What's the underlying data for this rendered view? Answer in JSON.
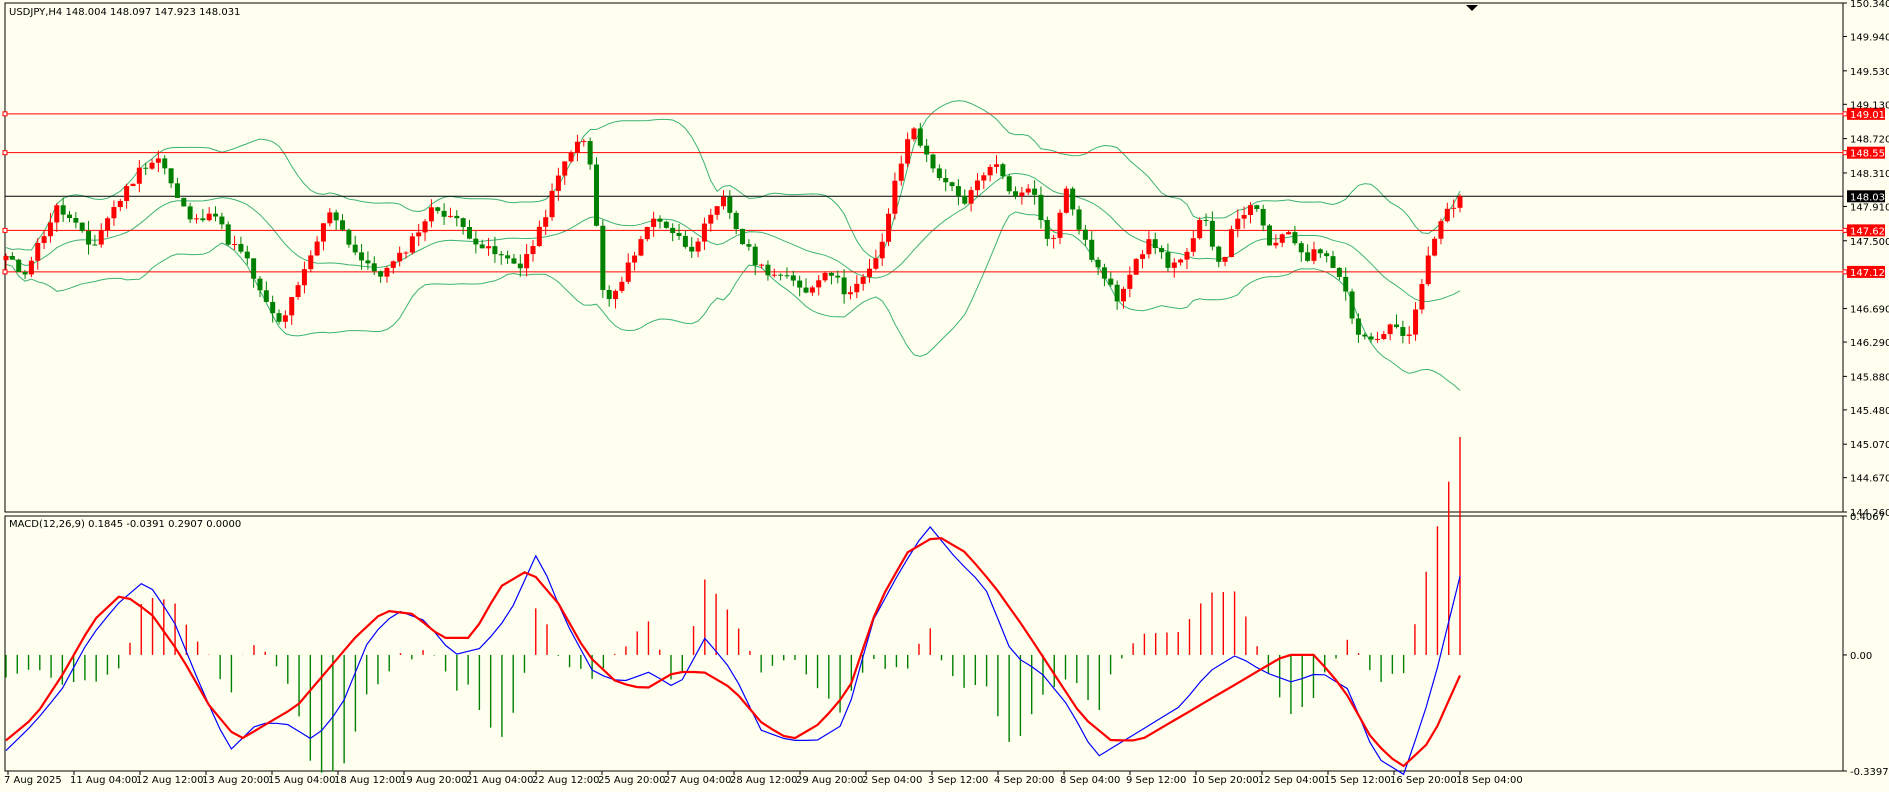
{
  "header": {
    "main_info": "USDJPY,H4  148.004 148.097 147.923 148.031",
    "macd_info": "MACD(12,26,9) 0.1845 -0.0391 0.2907 0.0000"
  },
  "colors": {
    "background": "#fffff0",
    "bull": "#ff0000",
    "bear": "#008000",
    "bollinger": "#3cb371",
    "level_line": "#ff0000",
    "current_price_line": "#000000",
    "macd_line": "#0000ff",
    "signal_line": "#ff0000",
    "hist_pos": "#ff0000",
    "hist_neg": "#008000"
  },
  "chart_data": [
    {
      "type": "candlestick",
      "symbol": "USDJPY",
      "timeframe": "H4",
      "ylim": [
        144.26,
        150.34
      ],
      "y_ticks": [
        "150.340",
        "149.940",
        "149.530",
        "149.130",
        "148.720",
        "148.310",
        "147.910",
        "147.500",
        "146.690",
        "146.290",
        "145.880",
        "145.480",
        "145.070",
        "144.670",
        "144.260"
      ],
      "x_ticks": [
        "7 Aug 2025",
        "11 Aug 04:00",
        "12 Aug 12:00",
        "13 Aug 20:00",
        "15 Aug 04:00",
        "18 Aug 12:00",
        "19 Aug 20:00",
        "21 Aug 04:00",
        "22 Aug 12:00",
        "25 Aug 20:00",
        "27 Aug 04:00",
        "28 Aug 12:00",
        "29 Aug 20:00",
        "2 Sep 04:00",
        "3 Sep 12:00",
        "4 Sep 20:00",
        "8 Sep 04:00",
        "9 Sep 12:00",
        "10 Sep 20:00",
        "12 Sep 04:00",
        "15 Sep 12:00",
        "16 Sep 20:00",
        "18 Sep 04:00"
      ],
      "levels": [
        {
          "value": 149.016,
          "label": "149.016"
        },
        {
          "value": 148.552,
          "label": "148.552"
        },
        {
          "value": 147.624,
          "label": "147.624"
        },
        {
          "value": 147.128,
          "label": "147.128"
        }
      ],
      "current_price": {
        "value": 148.031,
        "label": "148.031"
      },
      "anchors": [
        147.3,
        147.1,
        147.5,
        147.9,
        147.7,
        147.4,
        147.8,
        148.1,
        148.4,
        148.5,
        148.0,
        147.7,
        147.9,
        147.5,
        147.3,
        146.8,
        146.5,
        146.9,
        147.4,
        147.9,
        147.5,
        147.2,
        147.1,
        147.3,
        147.6,
        147.9,
        147.8,
        147.6,
        147.4,
        147.3,
        147.2,
        147.5,
        148.1,
        148.6,
        148.7,
        146.7,
        147.0,
        147.5,
        147.8,
        147.6,
        147.4,
        147.7,
        148.0,
        147.5,
        147.2,
        147.1,
        147.0,
        146.9,
        147.2,
        146.9,
        147.0,
        147.3,
        148.2,
        148.9,
        148.4,
        148.2,
        147.9,
        148.3,
        148.4,
        148.0,
        148.2,
        147.4,
        148.1,
        147.5,
        147.1,
        146.8,
        147.3,
        147.5,
        147.2,
        147.3,
        147.8,
        147.2,
        147.8,
        147.9,
        147.4,
        147.6,
        147.3,
        147.4,
        147.1,
        146.4,
        146.3,
        146.5,
        146.3,
        147.2,
        147.8,
        148.031
      ],
      "series_count": 230
    },
    {
      "type": "macd",
      "name": "MACD(12,26,9)",
      "ylim": [
        -0.3397,
        0.4067
      ],
      "y_ticks": [
        "0.4067",
        "0.00",
        "-0.3397"
      ],
      "macd_anchors": [
        -0.28,
        -0.2,
        -0.1,
        0.05,
        0.15,
        0.22,
        0.1,
        -0.1,
        -0.28,
        -0.2,
        -0.2,
        -0.25,
        -0.15,
        0.05,
        0.13,
        0.1,
        0.0,
        0.02,
        0.12,
        0.3,
        0.1,
        -0.05,
        -0.08,
        -0.05,
        -0.1,
        0.05,
        -0.05,
        -0.22,
        -0.25,
        -0.25,
        -0.2,
        0.1,
        0.25,
        0.38,
        0.28,
        0.2,
        0.0,
        -0.05,
        -0.15,
        -0.3,
        -0.25,
        -0.2,
        -0.15,
        -0.05,
        0.0,
        -0.05,
        -0.08,
        -0.05,
        -0.1,
        -0.3,
        -0.35,
        -0.1,
        0.23
      ],
      "signal_anchors": [
        -0.25,
        -0.18,
        -0.05,
        0.1,
        0.18,
        0.12,
        0.0,
        -0.15,
        -0.25,
        -0.2,
        -0.15,
        -0.05,
        0.05,
        0.13,
        0.12,
        0.05,
        0.05,
        0.2,
        0.25,
        0.15,
        0.0,
        -0.08,
        -0.1,
        -0.05,
        -0.05,
        -0.1,
        -0.2,
        -0.25,
        -0.2,
        -0.1,
        0.15,
        0.3,
        0.35,
        0.3,
        0.2,
        0.08,
        -0.05,
        -0.18,
        -0.25,
        -0.25,
        -0.2,
        -0.15,
        -0.1,
        -0.05,
        0.0,
        0.0,
        -0.1,
        -0.25,
        -0.33,
        -0.25,
        -0.06
      ]
    }
  ]
}
